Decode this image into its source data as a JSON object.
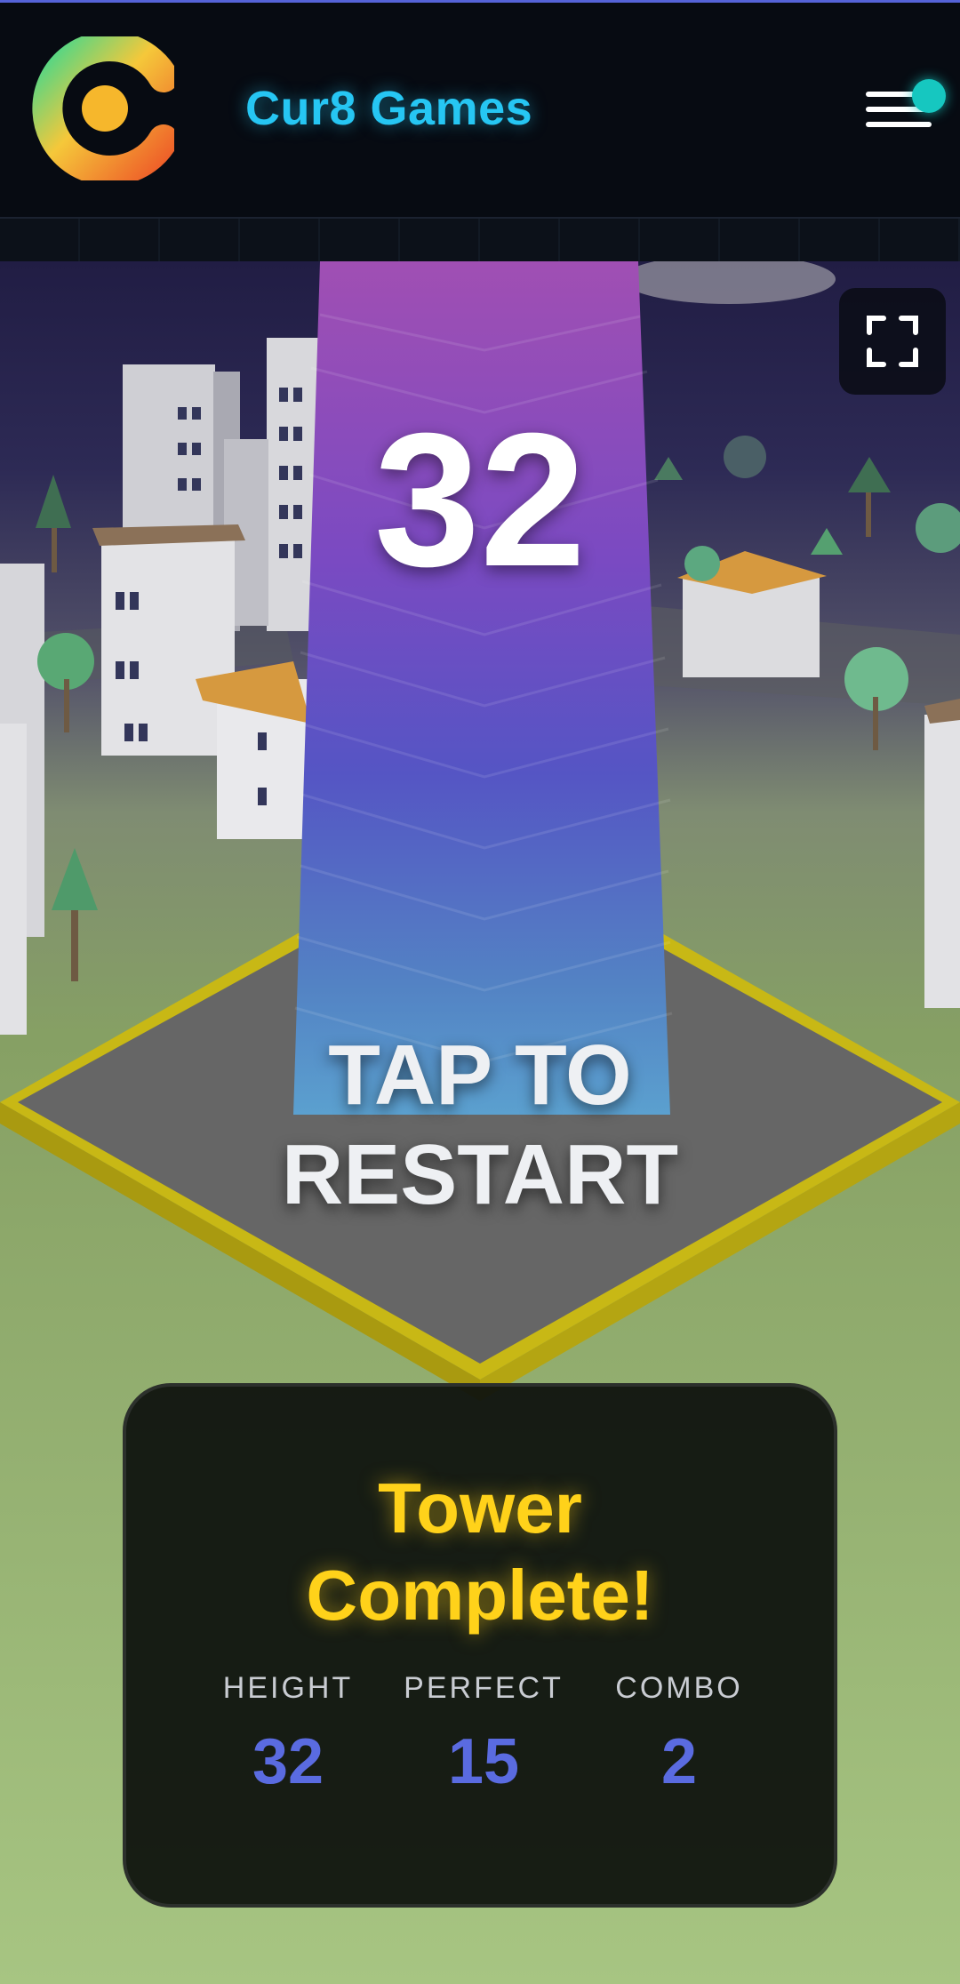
{
  "header": {
    "brand": "Cur8 Games",
    "logo_icon": "cur8-logo-icon",
    "menu_icon": "hamburger-menu-icon",
    "notification_dot_color": "#16c7c0",
    "brand_color": "#26c6f3"
  },
  "game": {
    "score": "32",
    "tap_line1": "TAP TO",
    "tap_line2": "RESTART",
    "fullscreen_icon": "fullscreen-icon"
  },
  "result": {
    "title_line1": "Tower",
    "title_line2": "Complete!",
    "stats": [
      {
        "label": "HEIGHT",
        "value": "32"
      },
      {
        "label": "PERFECT",
        "value": "15"
      },
      {
        "label": "COMBO",
        "value": "2"
      }
    ],
    "title_color": "#ffd21a",
    "value_color": "#5a6be0"
  }
}
